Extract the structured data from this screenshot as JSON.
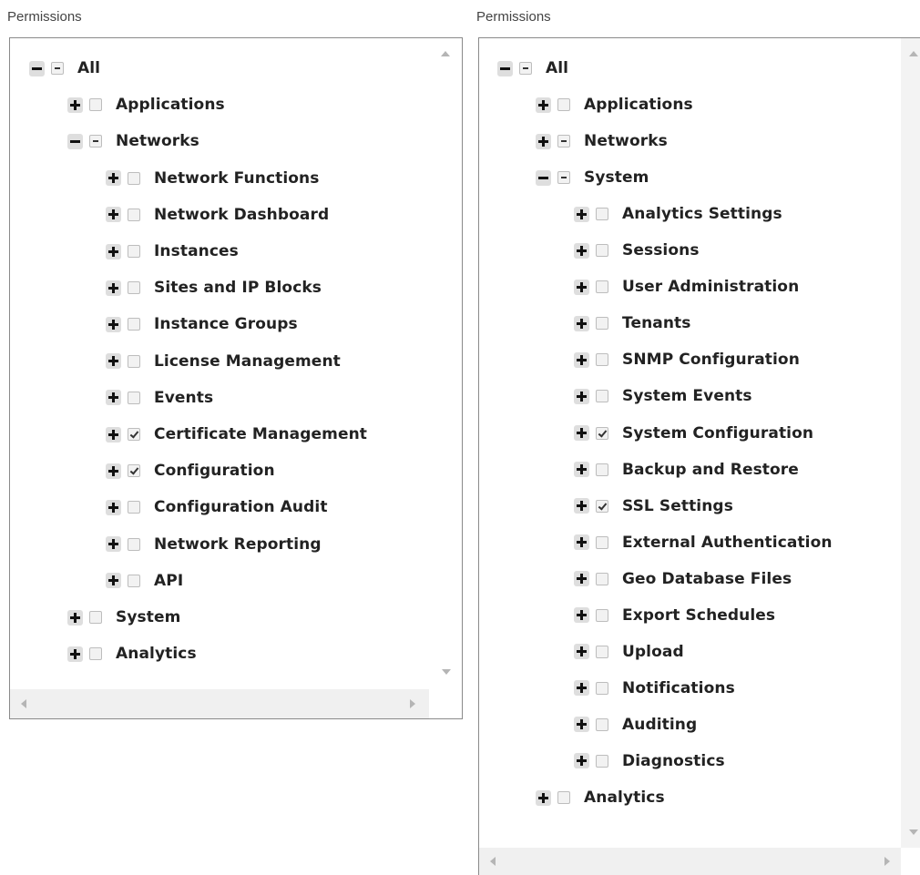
{
  "left_panel": {
    "title": "Permissions",
    "rows": [
      {
        "label": "All",
        "level": 0,
        "expanded": true,
        "check": "partial"
      },
      {
        "label": "Applications",
        "level": 1,
        "expanded": false,
        "check": "none"
      },
      {
        "label": "Networks",
        "level": 1,
        "expanded": true,
        "check": "partial"
      },
      {
        "label": "Network Functions",
        "level": 2,
        "expanded": false,
        "check": "none"
      },
      {
        "label": "Network Dashboard",
        "level": 2,
        "expanded": false,
        "check": "none"
      },
      {
        "label": "Instances",
        "level": 2,
        "expanded": false,
        "check": "none"
      },
      {
        "label": "Sites and IP Blocks",
        "level": 2,
        "expanded": false,
        "check": "none"
      },
      {
        "label": "Instance Groups",
        "level": 2,
        "expanded": false,
        "check": "none"
      },
      {
        "label": "License Management",
        "level": 2,
        "expanded": false,
        "check": "none"
      },
      {
        "label": "Events",
        "level": 2,
        "expanded": false,
        "check": "none"
      },
      {
        "label": "Certificate Management",
        "level": 2,
        "expanded": false,
        "check": "checked"
      },
      {
        "label": "Configuration",
        "level": 2,
        "expanded": false,
        "check": "checked"
      },
      {
        "label": "Configuration Audit",
        "level": 2,
        "expanded": false,
        "check": "none"
      },
      {
        "label": "Network Reporting",
        "level": 2,
        "expanded": false,
        "check": "none"
      },
      {
        "label": "API",
        "level": 2,
        "expanded": false,
        "check": "none"
      },
      {
        "label": "System",
        "level": 1,
        "expanded": false,
        "check": "none"
      },
      {
        "label": "Analytics",
        "level": 1,
        "expanded": false,
        "check": "none"
      }
    ]
  },
  "right_panel": {
    "title": "Permissions",
    "rows": [
      {
        "label": "All",
        "level": 0,
        "expanded": true,
        "check": "partial"
      },
      {
        "label": "Applications",
        "level": 1,
        "expanded": false,
        "check": "none"
      },
      {
        "label": "Networks",
        "level": 1,
        "expanded": false,
        "check": "partial"
      },
      {
        "label": "System",
        "level": 1,
        "expanded": true,
        "check": "partial"
      },
      {
        "label": "Analytics Settings",
        "level": 2,
        "expanded": false,
        "check": "none"
      },
      {
        "label": "Sessions",
        "level": 2,
        "expanded": false,
        "check": "none"
      },
      {
        "label": "User Administration",
        "level": 2,
        "expanded": false,
        "check": "none"
      },
      {
        "label": "Tenants",
        "level": 2,
        "expanded": false,
        "check": "none"
      },
      {
        "label": "SNMP Configuration",
        "level": 2,
        "expanded": false,
        "check": "none"
      },
      {
        "label": "System Events",
        "level": 2,
        "expanded": false,
        "check": "none"
      },
      {
        "label": "System Configuration",
        "level": 2,
        "expanded": false,
        "check": "checked"
      },
      {
        "label": "Backup and Restore",
        "level": 2,
        "expanded": false,
        "check": "none"
      },
      {
        "label": "SSL Settings",
        "level": 2,
        "expanded": false,
        "check": "checked"
      },
      {
        "label": "External Authentication",
        "level": 2,
        "expanded": false,
        "check": "none"
      },
      {
        "label": "Geo Database Files",
        "level": 2,
        "expanded": false,
        "check": "none"
      },
      {
        "label": "Export Schedules",
        "level": 2,
        "expanded": false,
        "check": "none"
      },
      {
        "label": "Upload",
        "level": 2,
        "expanded": false,
        "check": "none"
      },
      {
        "label": "Notifications",
        "level": 2,
        "expanded": false,
        "check": "none"
      },
      {
        "label": "Auditing",
        "level": 2,
        "expanded": false,
        "check": "none"
      },
      {
        "label": "Diagnostics",
        "level": 2,
        "expanded": false,
        "check": "none"
      },
      {
        "label": "Analytics",
        "level": 1,
        "expanded": false,
        "check": "none"
      }
    ]
  }
}
